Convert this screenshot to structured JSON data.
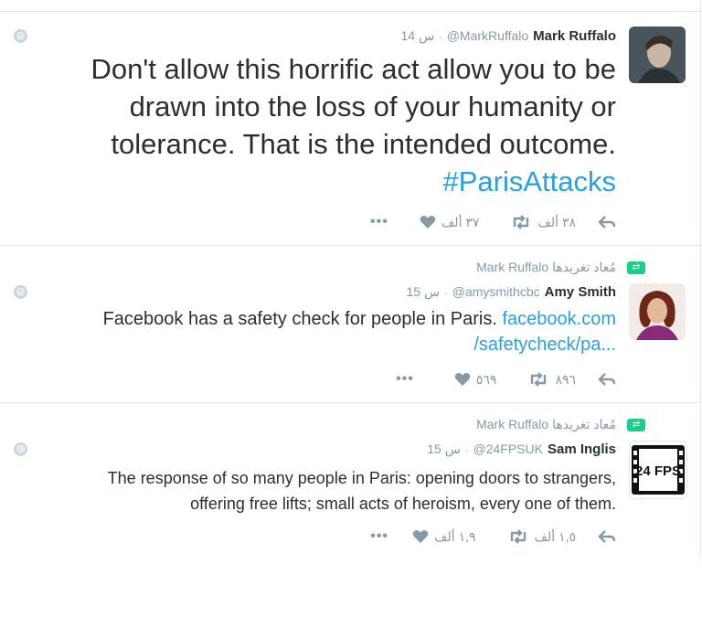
{
  "tweets": [
    {
      "retweet_context": null,
      "name": "Mark Ruffalo",
      "handle": "@MarkRuffalo",
      "time": "14 س",
      "text": "Don't allow this horrific act allow you to be drawn into the loss of your humanity or tolerance. That is the intended outcome.",
      "hashtag": "#ParisAttacks",
      "retweets": "٣٨ ألف",
      "likes": "٣٧ ألف",
      "more": "•••"
    },
    {
      "retweet_context": "Mark Ruffalo مُعاد تغريدها",
      "name": "Amy Smith",
      "handle": "@amysmithcbc",
      "time": "15 س",
      "text": "Facebook has a safety check for people in Paris.",
      "link_line1": "facebook.com",
      "link_line2": "/safetycheck/pa...",
      "retweets": "٨٩٦",
      "likes": "٥٦٩",
      "more": "•••"
    },
    {
      "retweet_context": "Mark Ruffalo مُعاد تغريدها",
      "name": "Sam Inglis",
      "handle": "@24FPSUK",
      "time": "15 س",
      "text_line1": "The response of so many people in Paris: opening doors to strangers,",
      "text_line2": "offering free lifts; small acts of heroism, every one of them.",
      "avatar_label": "24 FPS",
      "retweets": "١,٥ ألف",
      "likes": "١,٩ ألف",
      "more": "•••"
    }
  ],
  "colors": {
    "link": "#2b9ee0",
    "muted": "#8899a6",
    "retweet_green": "#19cf86"
  }
}
